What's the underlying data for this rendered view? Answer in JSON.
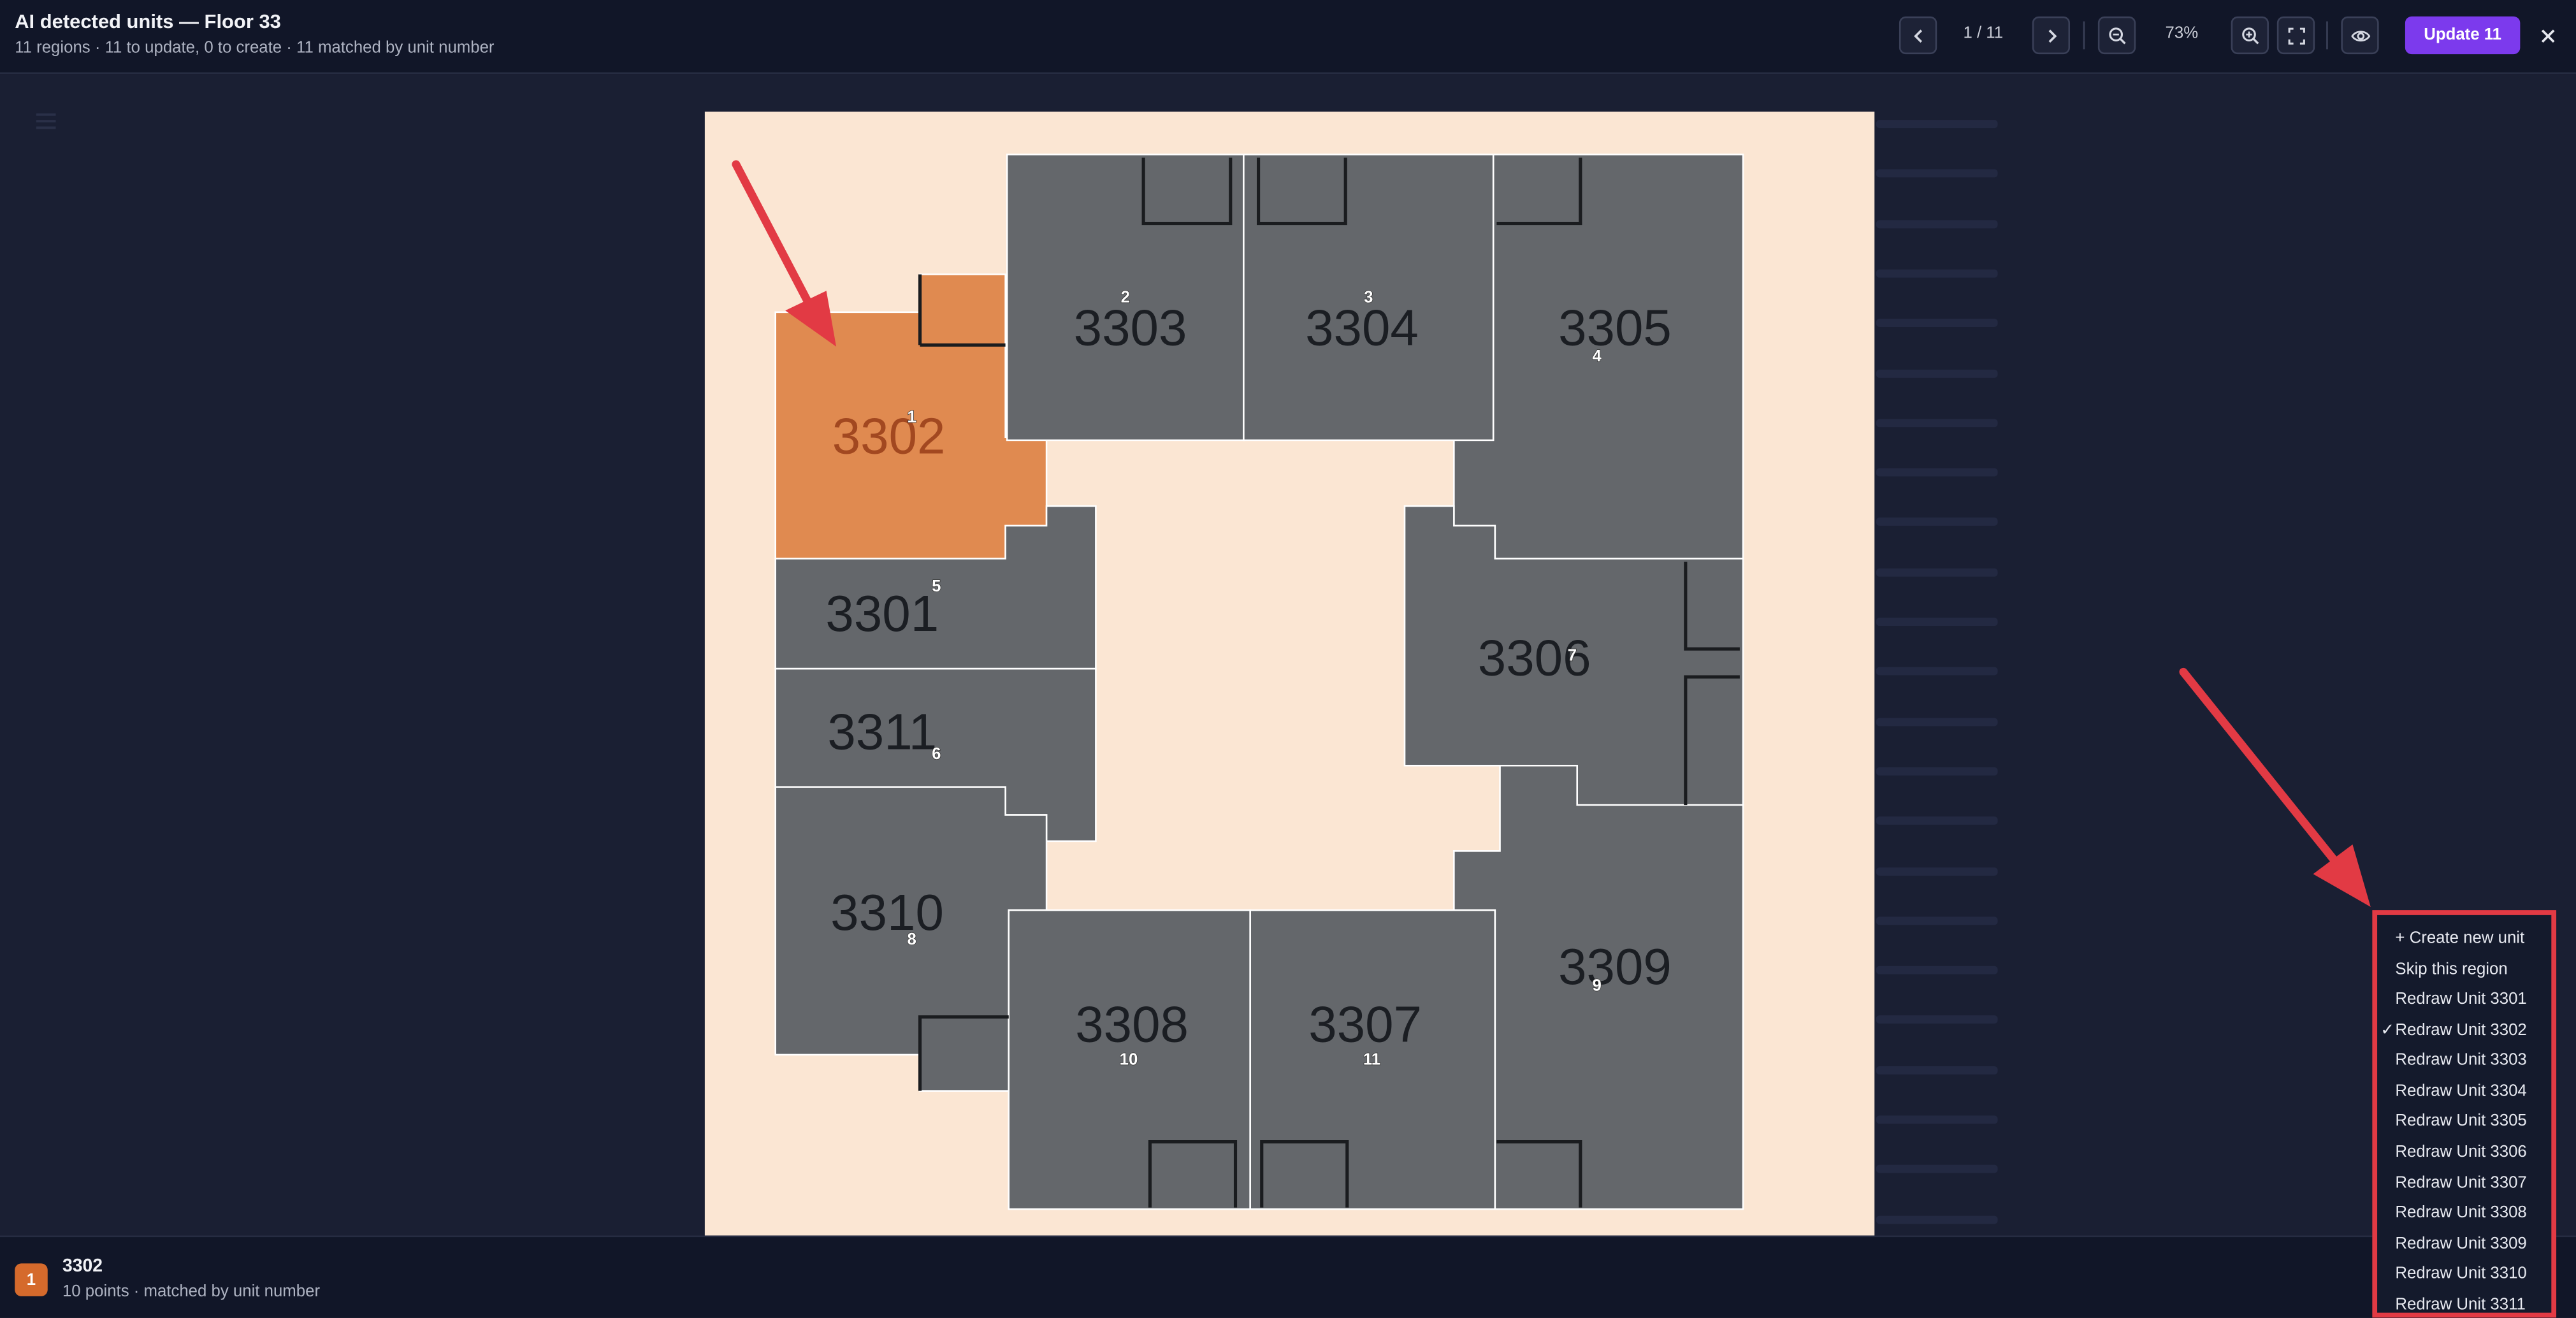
{
  "header": {
    "title": "AI detected units — Floor 33",
    "subtitle": "11 regions · 11 to update, 0 to create · 11 matched by unit number",
    "pager": "1 / 11",
    "zoom": "73%",
    "update_label": "Update 11"
  },
  "icons": {
    "prev": "chevron-left-icon",
    "next": "chevron-right-icon",
    "zoom_out": "zoom-out-icon",
    "zoom_in": "zoom-in-icon",
    "fit": "fullscreen-icon",
    "preview": "eye-icon",
    "close": "close-icon",
    "menu": "menu-icon"
  },
  "colors": {
    "accent": "#7c3aed",
    "selected_unit": "#e08a50",
    "unit_fill": "#64676b",
    "canvas_bg": "#fbe6d3",
    "annotation": "#e23a44"
  },
  "units": [
    {
      "number": "3302",
      "region": "1",
      "selected": true
    },
    {
      "number": "3303",
      "region": "2"
    },
    {
      "number": "3304",
      "region": "3"
    },
    {
      "number": "3305",
      "region": "4"
    },
    {
      "number": "3301",
      "region": "5"
    },
    {
      "number": "3311",
      "region": "6"
    },
    {
      "number": "3306",
      "region": "7"
    },
    {
      "number": "3310",
      "region": "8"
    },
    {
      "number": "3309",
      "region": "9"
    },
    {
      "number": "3308",
      "region": "10"
    },
    {
      "number": "3307",
      "region": "11"
    }
  ],
  "footer": {
    "badge": "1",
    "unit": "3302",
    "detail": "10 points · matched by unit number"
  },
  "dropdown": {
    "items": [
      "+ Create new unit",
      "Skip this region",
      "Redraw Unit 3301",
      "Redraw Unit 3302",
      "Redraw Unit 3303",
      "Redraw Unit 3304",
      "Redraw Unit 3305",
      "Redraw Unit 3306",
      "Redraw Unit 3307",
      "Redraw Unit 3308",
      "Redraw Unit 3309",
      "Redraw Unit 3310",
      "Redraw Unit 3311"
    ],
    "selected_index": 3,
    "check": "✓"
  }
}
